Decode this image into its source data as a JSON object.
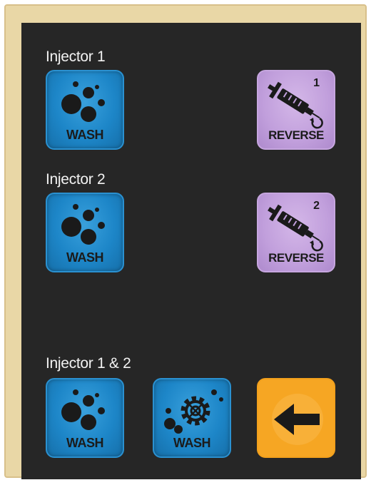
{
  "sections": [
    {
      "label": "Injector 1"
    },
    {
      "label": "Injector 2"
    },
    {
      "label": "Injector 1 & 2"
    }
  ],
  "buttons": {
    "inj1_wash": {
      "label": "WASH"
    },
    "inj1_reverse": {
      "label": "REVERSE",
      "injector_number": "1"
    },
    "inj2_wash": {
      "label": "WASH"
    },
    "inj2_reverse": {
      "label": "REVERSE",
      "injector_number": "2"
    },
    "both_wash": {
      "label": "WASH"
    },
    "both_gear_wash": {
      "label": "WASH"
    },
    "back": {
      "icon": "back-arrow-icon"
    }
  },
  "icons": {
    "wash": "bubbles-icon",
    "reverse": "syringe-icon",
    "gear_wash": "gear-bubbles-icon",
    "back": "back-arrow-icon"
  },
  "colors": {
    "screen_bg": "#262626",
    "frame": "#e9d7a6",
    "wash_button": "#1d86c8",
    "reverse_button": "#c19fdc",
    "back_button": "#f6a623",
    "label_text": "#f2f2f2"
  }
}
